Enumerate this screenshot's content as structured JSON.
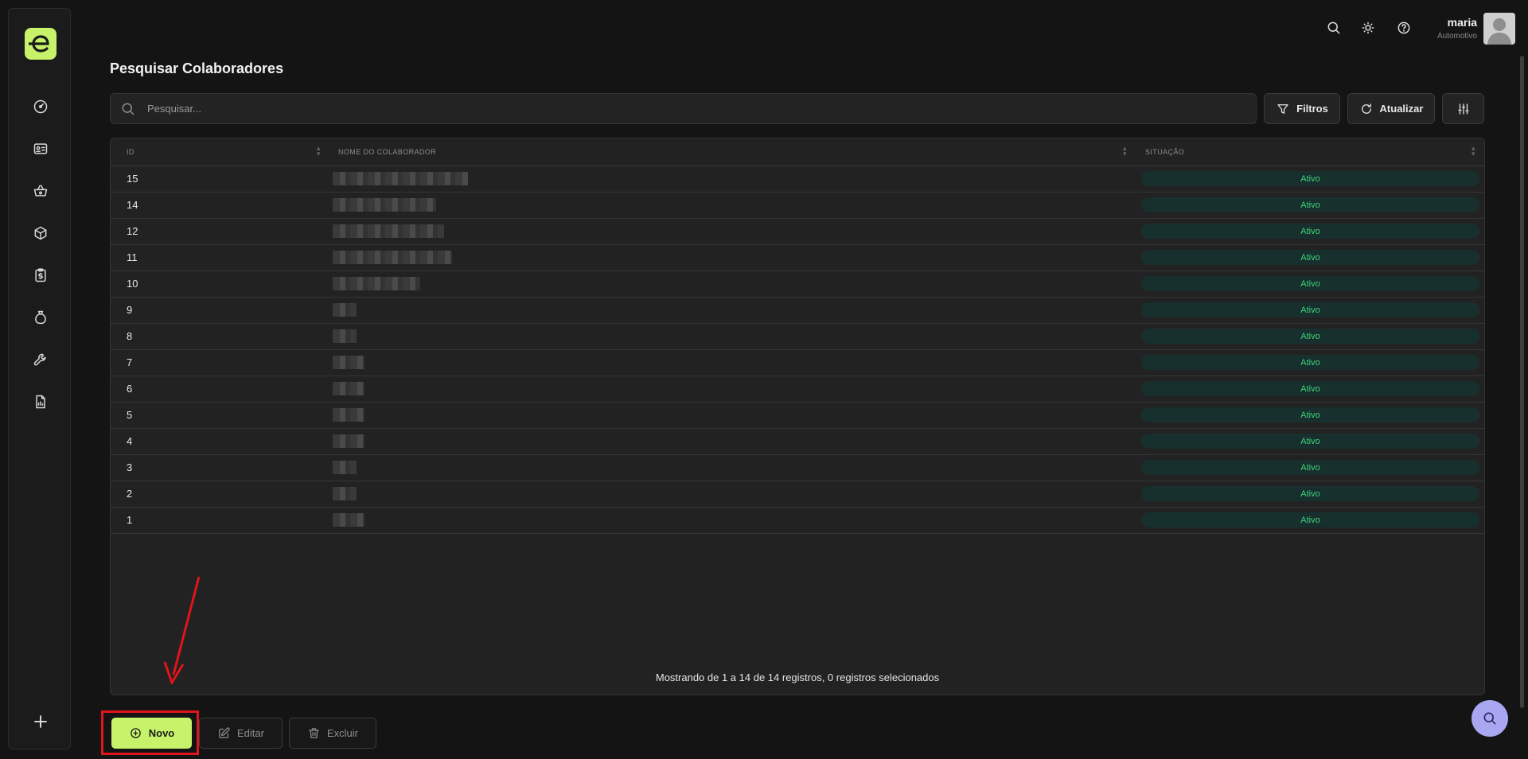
{
  "header": {
    "user_name": "maria",
    "user_subtitle": "Automotivo"
  },
  "page": {
    "title": "Pesquisar Colaboradores"
  },
  "search": {
    "placeholder": "Pesquisar..."
  },
  "toolbar": {
    "filters_label": "Filtros",
    "refresh_label": "Atualizar"
  },
  "table": {
    "columns": [
      "ID",
      "NOME DO COLABORADOR",
      "SITUAÇÃO"
    ],
    "rows": [
      {
        "id": "15",
        "status": "Ativo"
      },
      {
        "id": "14",
        "status": "Ativo"
      },
      {
        "id": "12",
        "status": "Ativo"
      },
      {
        "id": "11",
        "status": "Ativo"
      },
      {
        "id": "10",
        "status": "Ativo"
      },
      {
        "id": "9",
        "status": "Ativo"
      },
      {
        "id": "8",
        "status": "Ativo"
      },
      {
        "id": "7",
        "status": "Ativo"
      },
      {
        "id": "6",
        "status": "Ativo"
      },
      {
        "id": "5",
        "status": "Ativo"
      },
      {
        "id": "4",
        "status": "Ativo"
      },
      {
        "id": "3",
        "status": "Ativo"
      },
      {
        "id": "2",
        "status": "Ativo"
      },
      {
        "id": "1",
        "status": "Ativo"
      }
    ],
    "footer": "Mostrando de 1 a 14 de 14 registros, 0 registros selecionados"
  },
  "actions": {
    "new_label": "Novo",
    "edit_label": "Editar",
    "delete_label": "Excluir"
  },
  "colors": {
    "accent": "#c6f36a",
    "status_active": "#3fd27a",
    "highlight": "#e0151b",
    "fab": "#a9a7f2"
  },
  "icons": {
    "sidebar": [
      "dashboard-icon",
      "id-card-icon",
      "basket-icon",
      "box-icon",
      "clipboard-dollar-icon",
      "money-bag-icon",
      "wrench-icon",
      "report-icon"
    ]
  }
}
